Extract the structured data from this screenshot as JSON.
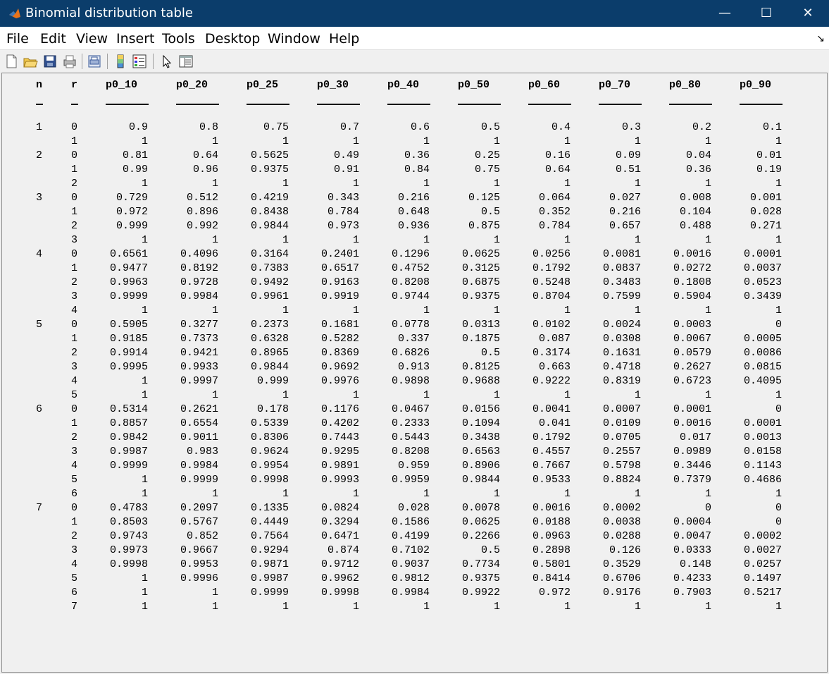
{
  "window": {
    "title": "Binomial distribution table",
    "minimize": "—",
    "maximize": "☐",
    "close": "✕"
  },
  "menu": [
    "File",
    "Edit",
    "View",
    "Insert",
    "Tools",
    "Desktop",
    "Window",
    "Help"
  ],
  "toolbar": [
    "new-figure-icon",
    "open-icon",
    "save-icon",
    "print-icon",
    "print-preview-icon",
    "colorbar-icon",
    "legend-icon",
    "pointer-icon",
    "property-editor-icon"
  ],
  "table": {
    "headers": [
      "n",
      "r",
      "p0_10",
      "p0_20",
      "p0_25",
      "p0_30",
      "p0_40",
      "p0_50",
      "p0_60",
      "p0_70",
      "p0_80",
      "p0_90"
    ],
    "underline": "_",
    "underline_long": "______",
    "rows": [
      [
        "1",
        "0",
        "0.9",
        "0.8",
        "0.75",
        "0.7",
        "0.6",
        "0.5",
        "0.4",
        "0.3",
        "0.2",
        "0.1"
      ],
      [
        "",
        "1",
        "1",
        "1",
        "1",
        "1",
        "1",
        "1",
        "1",
        "1",
        "1",
        "1"
      ],
      [
        "2",
        "0",
        "0.81",
        "0.64",
        "0.5625",
        "0.49",
        "0.36",
        "0.25",
        "0.16",
        "0.09",
        "0.04",
        "0.01"
      ],
      [
        "",
        "1",
        "0.99",
        "0.96",
        "0.9375",
        "0.91",
        "0.84",
        "0.75",
        "0.64",
        "0.51",
        "0.36",
        "0.19"
      ],
      [
        "",
        "2",
        "1",
        "1",
        "1",
        "1",
        "1",
        "1",
        "1",
        "1",
        "1",
        "1"
      ],
      [
        "3",
        "0",
        "0.729",
        "0.512",
        "0.4219",
        "0.343",
        "0.216",
        "0.125",
        "0.064",
        "0.027",
        "0.008",
        "0.001"
      ],
      [
        "",
        "1",
        "0.972",
        "0.896",
        "0.8438",
        "0.784",
        "0.648",
        "0.5",
        "0.352",
        "0.216",
        "0.104",
        "0.028"
      ],
      [
        "",
        "2",
        "0.999",
        "0.992",
        "0.9844",
        "0.973",
        "0.936",
        "0.875",
        "0.784",
        "0.657",
        "0.488",
        "0.271"
      ],
      [
        "",
        "3",
        "1",
        "1",
        "1",
        "1",
        "1",
        "1",
        "1",
        "1",
        "1",
        "1"
      ],
      [
        "4",
        "0",
        "0.6561",
        "0.4096",
        "0.3164",
        "0.2401",
        "0.1296",
        "0.0625",
        "0.0256",
        "0.0081",
        "0.0016",
        "0.0001"
      ],
      [
        "",
        "1",
        "0.9477",
        "0.8192",
        "0.7383",
        "0.6517",
        "0.4752",
        "0.3125",
        "0.1792",
        "0.0837",
        "0.0272",
        "0.0037"
      ],
      [
        "",
        "2",
        "0.9963",
        "0.9728",
        "0.9492",
        "0.9163",
        "0.8208",
        "0.6875",
        "0.5248",
        "0.3483",
        "0.1808",
        "0.0523"
      ],
      [
        "",
        "3",
        "0.9999",
        "0.9984",
        "0.9961",
        "0.9919",
        "0.9744",
        "0.9375",
        "0.8704",
        "0.7599",
        "0.5904",
        "0.3439"
      ],
      [
        "",
        "4",
        "1",
        "1",
        "1",
        "1",
        "1",
        "1",
        "1",
        "1",
        "1",
        "1"
      ],
      [
        "5",
        "0",
        "0.5905",
        "0.3277",
        "0.2373",
        "0.1681",
        "0.0778",
        "0.0313",
        "0.0102",
        "0.0024",
        "0.0003",
        "0"
      ],
      [
        "",
        "1",
        "0.9185",
        "0.7373",
        "0.6328",
        "0.5282",
        "0.337",
        "0.1875",
        "0.087",
        "0.0308",
        "0.0067",
        "0.0005"
      ],
      [
        "",
        "2",
        "0.9914",
        "0.9421",
        "0.8965",
        "0.8369",
        "0.6826",
        "0.5",
        "0.3174",
        "0.1631",
        "0.0579",
        "0.0086"
      ],
      [
        "",
        "3",
        "0.9995",
        "0.9933",
        "0.9844",
        "0.9692",
        "0.913",
        "0.8125",
        "0.663",
        "0.4718",
        "0.2627",
        "0.0815"
      ],
      [
        "",
        "4",
        "1",
        "0.9997",
        "0.999",
        "0.9976",
        "0.9898",
        "0.9688",
        "0.9222",
        "0.8319",
        "0.6723",
        "0.4095"
      ],
      [
        "",
        "5",
        "1",
        "1",
        "1",
        "1",
        "1",
        "1",
        "1",
        "1",
        "1",
        "1"
      ],
      [
        "6",
        "0",
        "0.5314",
        "0.2621",
        "0.178",
        "0.1176",
        "0.0467",
        "0.0156",
        "0.0041",
        "0.0007",
        "0.0001",
        "0"
      ],
      [
        "",
        "1",
        "0.8857",
        "0.6554",
        "0.5339",
        "0.4202",
        "0.2333",
        "0.1094",
        "0.041",
        "0.0109",
        "0.0016",
        "0.0001"
      ],
      [
        "",
        "2",
        "0.9842",
        "0.9011",
        "0.8306",
        "0.7443",
        "0.5443",
        "0.3438",
        "0.1792",
        "0.0705",
        "0.017",
        "0.0013"
      ],
      [
        "",
        "3",
        "0.9987",
        "0.983",
        "0.9624",
        "0.9295",
        "0.8208",
        "0.6563",
        "0.4557",
        "0.2557",
        "0.0989",
        "0.0158"
      ],
      [
        "",
        "4",
        "0.9999",
        "0.9984",
        "0.9954",
        "0.9891",
        "0.959",
        "0.8906",
        "0.7667",
        "0.5798",
        "0.3446",
        "0.1143"
      ],
      [
        "",
        "5",
        "1",
        "0.9999",
        "0.9998",
        "0.9993",
        "0.9959",
        "0.9844",
        "0.9533",
        "0.8824",
        "0.7379",
        "0.4686"
      ],
      [
        "",
        "6",
        "1",
        "1",
        "1",
        "1",
        "1",
        "1",
        "1",
        "1",
        "1",
        "1"
      ],
      [
        "7",
        "0",
        "0.4783",
        "0.2097",
        "0.1335",
        "0.0824",
        "0.028",
        "0.0078",
        "0.0016",
        "0.0002",
        "0",
        "0"
      ],
      [
        "",
        "1",
        "0.8503",
        "0.5767",
        "0.4449",
        "0.3294",
        "0.1586",
        "0.0625",
        "0.0188",
        "0.0038",
        "0.0004",
        "0"
      ],
      [
        "",
        "2",
        "0.9743",
        "0.852",
        "0.7564",
        "0.6471",
        "0.4199",
        "0.2266",
        "0.0963",
        "0.0288",
        "0.0047",
        "0.0002"
      ],
      [
        "",
        "3",
        "0.9973",
        "0.9667",
        "0.9294",
        "0.874",
        "0.7102",
        "0.5",
        "0.2898",
        "0.126",
        "0.0333",
        "0.0027"
      ],
      [
        "",
        "4",
        "0.9998",
        "0.9953",
        "0.9871",
        "0.9712",
        "0.9037",
        "0.7734",
        "0.5801",
        "0.3529",
        "0.148",
        "0.0257"
      ],
      [
        "",
        "5",
        "1",
        "0.9996",
        "0.9987",
        "0.9962",
        "0.9812",
        "0.9375",
        "0.8414",
        "0.6706",
        "0.4233",
        "0.1497"
      ],
      [
        "",
        "6",
        "1",
        "1",
        "0.9999",
        "0.9998",
        "0.9984",
        "0.9922",
        "0.972",
        "0.9176",
        "0.7903",
        "0.5217"
      ],
      [
        "",
        "7",
        "1",
        "1",
        "1",
        "1",
        "1",
        "1",
        "1",
        "1",
        "1",
        "1"
      ]
    ]
  }
}
